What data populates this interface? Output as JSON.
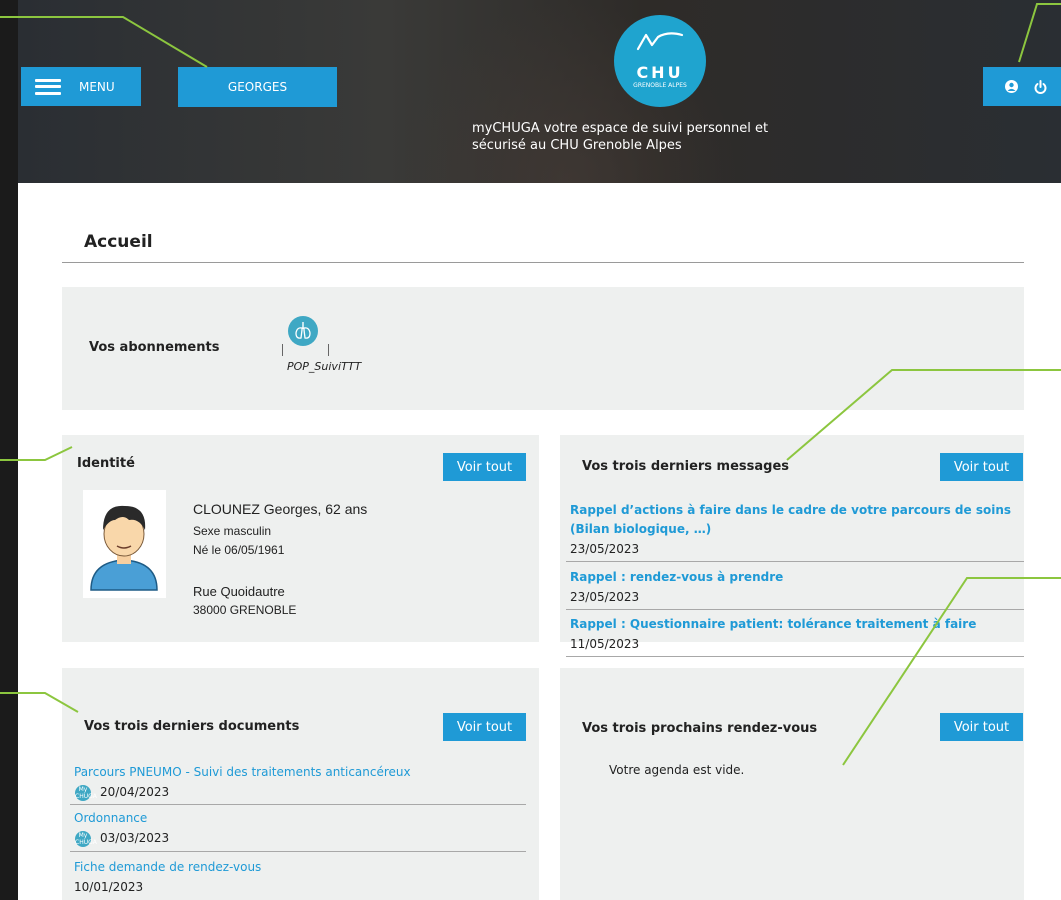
{
  "header": {
    "menu_label": "MENU",
    "user_button": "GEORGES",
    "logo": {
      "brand": "CHU",
      "sub": "GRENOBLE ALPES"
    },
    "tagline_line1": "myCHUGA votre espace de suivi personnel et",
    "tagline_line2": "sécurisé au CHU Grenoble Alpes",
    "icons": [
      "user-icon",
      "power-icon"
    ]
  },
  "page": {
    "title": "Accueil"
  },
  "subscriptions": {
    "label": "Vos abonnements",
    "items": [
      {
        "name": "POP_SuiviTTT",
        "icon": "lungs-icon"
      }
    ]
  },
  "identity": {
    "title": "Identité",
    "button": "Voir tout",
    "name_age": "CLOUNEZ Georges, 62 ans",
    "sex": "Sexe masculin",
    "birth": "Né le 06/05/1961",
    "street": "Rue Quoidautre",
    "city": "38000 GRENOBLE"
  },
  "messages": {
    "title": "Vos trois derniers messages",
    "button": "Voir tout",
    "items": [
      {
        "line1": "Rappel d’actions à faire dans le cadre de votre parcours de soins",
        "line2": "(Bilan biologique, …)",
        "date": "23/05/2023"
      },
      {
        "line1": "Rappel : rendez-vous à prendre",
        "date": "23/05/2023"
      },
      {
        "line1": "Rappel : Questionnaire patient: tolérance traitement à faire",
        "date": "11/05/2023"
      }
    ]
  },
  "documents": {
    "title": "Vos trois derniers documents",
    "button": "Voir tout",
    "items": [
      {
        "name": "Parcours PNEUMO - Suivi des traitements anticancéreux",
        "date": "20/04/2023",
        "badge": "My CHUGA"
      },
      {
        "name": "Ordonnance",
        "date": "03/03/2023",
        "badge": "My CHUGA"
      },
      {
        "name": "Fiche demande de rendez-vous",
        "date": "10/01/2023"
      }
    ]
  },
  "appointments": {
    "title": "Vos trois prochains rendez-vous",
    "button": "Voir tout",
    "empty": "Votre agenda est vide."
  },
  "colors": {
    "accent": "#1f9ad6",
    "panel": "#eef0ef",
    "annotation": "#8cc63f"
  }
}
